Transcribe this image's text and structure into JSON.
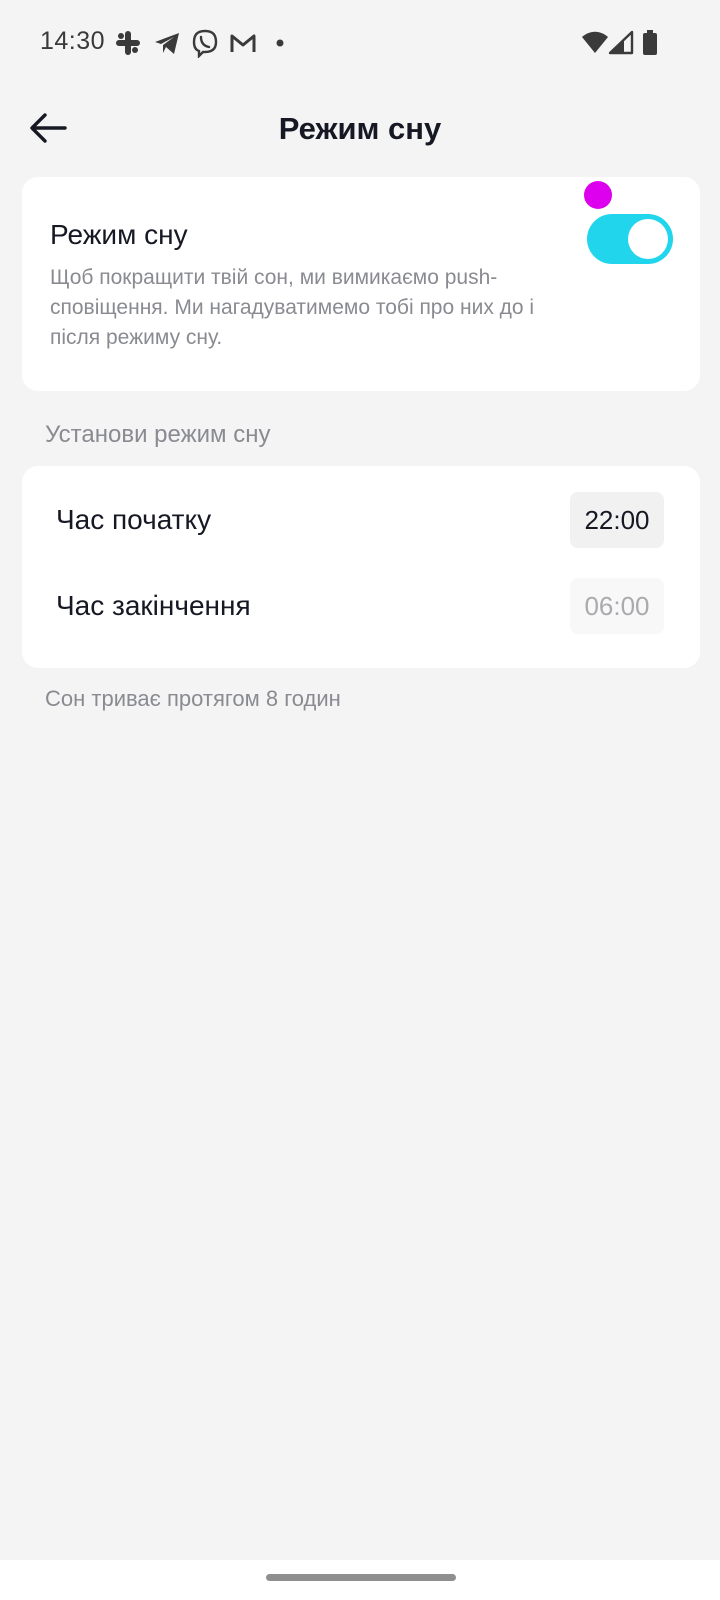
{
  "status_bar": {
    "time": "14:30",
    "notification_icons": [
      "slack-icon",
      "telegram-icon",
      "viber-icon",
      "gmail-icon",
      "more-dot-icon"
    ],
    "system_icons": [
      "wifi-icon",
      "signal-icon",
      "battery-icon"
    ]
  },
  "header": {
    "title": "Режим сну",
    "back_icon": "arrow-left-icon"
  },
  "sleep_mode": {
    "title": "Режим сну",
    "description": "Щоб покращити твій сон, ми вимикаємо push-сповіщення. Ми нагадуватимемо тобі про них до і після режиму сну.",
    "enabled": true
  },
  "schedule": {
    "section_label": "Установи режим сну",
    "start": {
      "label": "Час початку",
      "value": "22:00"
    },
    "end": {
      "label": "Час закінчення",
      "value": "06:00"
    },
    "duration_note": "Сон триває протягом 8 годин"
  },
  "colors": {
    "accent": "#20d5ec",
    "background": "#f4f4f4",
    "card": "#ffffff",
    "touch_indicator": "#dd00ee"
  }
}
